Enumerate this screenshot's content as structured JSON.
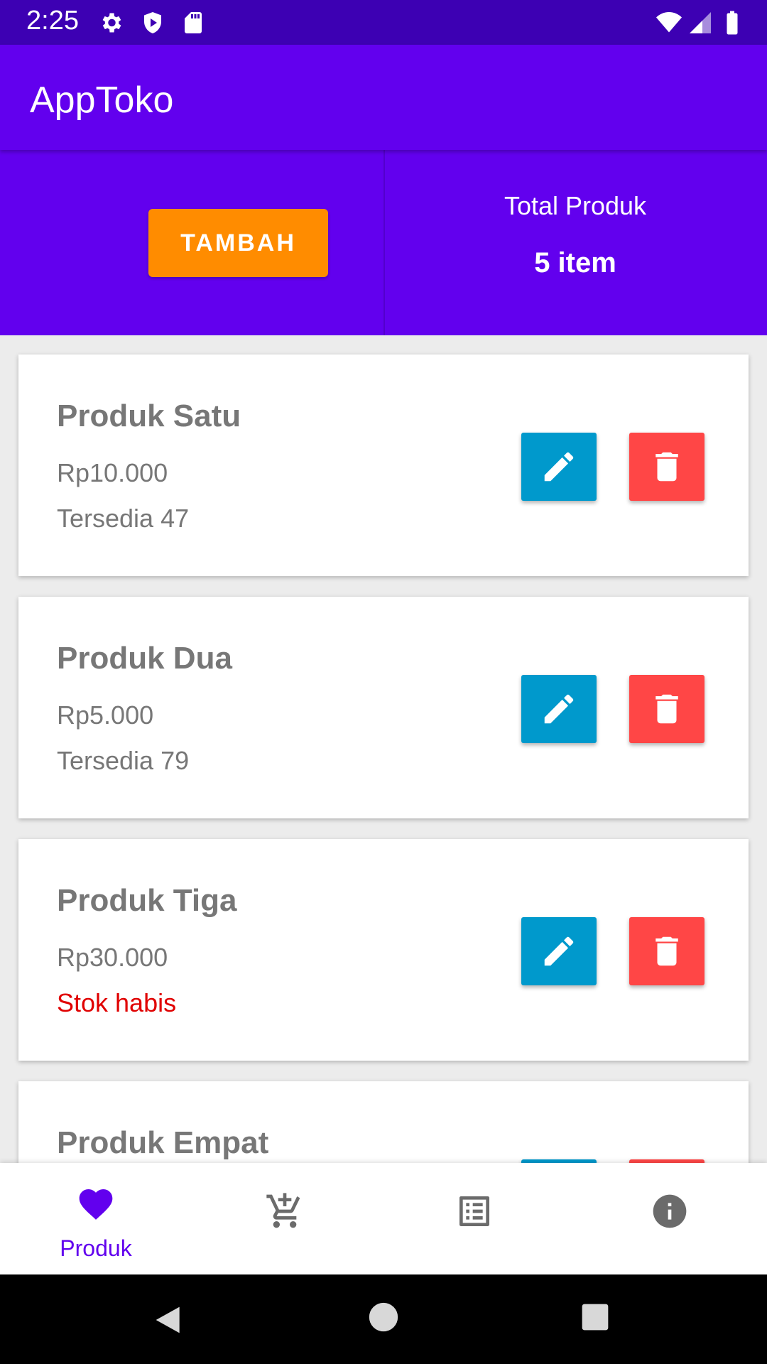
{
  "status_bar": {
    "time": "2:25",
    "icons": [
      "settings-icon",
      "shield-icon",
      "sd-card-icon",
      "wifi-icon",
      "signal-icon",
      "battery-icon"
    ]
  },
  "app_bar": {
    "title": "AppToko"
  },
  "header": {
    "add_button_label": "TAMBAH",
    "total_label": "Total Produk",
    "total_value": "5 item"
  },
  "products": [
    {
      "name": "Produk Satu",
      "price": "Rp10.000",
      "stock": "Tersedia 47"
    },
    {
      "name": "Produk Dua",
      "price": "Rp5.000",
      "stock": "Tersedia 79"
    },
    {
      "name": "Produk Tiga",
      "price": "Rp30.000",
      "stock": "Stok habis"
    },
    {
      "name": "Produk Empat"
    }
  ],
  "bottom_nav": {
    "active_label": "Produk",
    "items": [
      "heart-icon",
      "add-cart-icon",
      "list-icon",
      "info-icon"
    ]
  },
  "colors": {
    "primary": "#6200ee",
    "status_bar": "#3d00b3",
    "accent_button": "#ff8c00",
    "edit_button": "#0099cc",
    "delete_button": "#ff4646",
    "out_of_stock": "#e00000"
  }
}
